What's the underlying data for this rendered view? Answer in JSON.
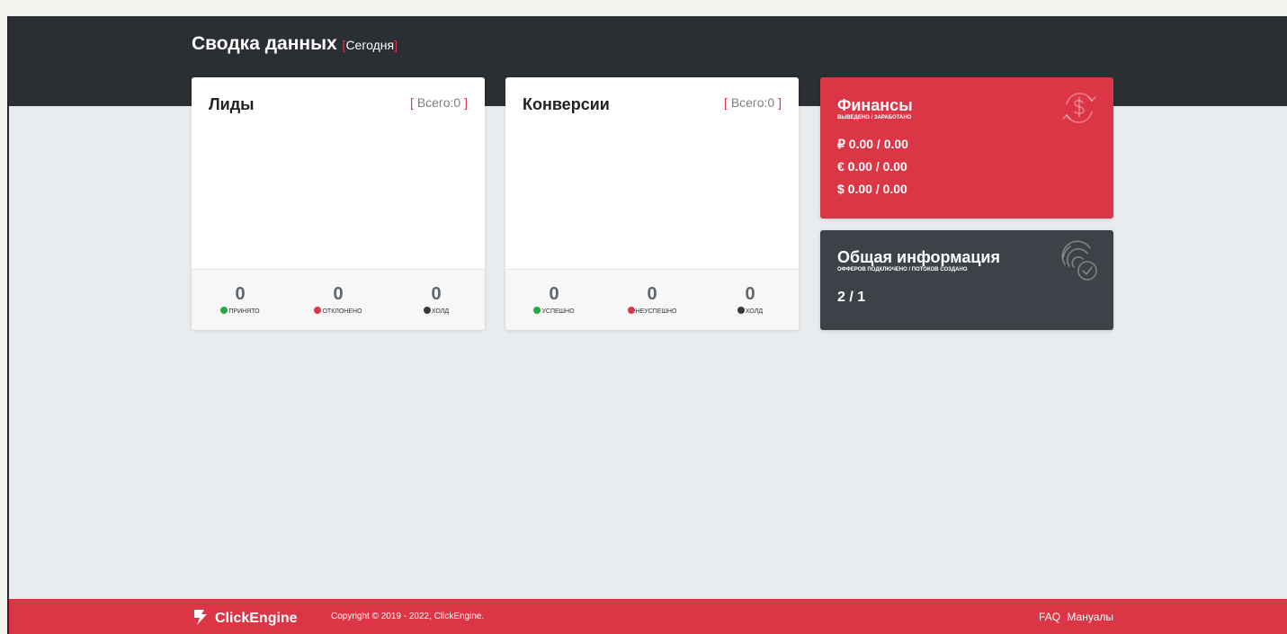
{
  "header": {
    "title": "Сводка данных",
    "bracket_open": "[",
    "period": "Сегодня",
    "bracket_close": "]"
  },
  "leads": {
    "title": "Лиды",
    "total_label": "Всего:",
    "total_value": "0",
    "stats": [
      {
        "value": "0",
        "label": "ПРИНЯТО",
        "color": "#28a745"
      },
      {
        "value": "0",
        "label": "ОТКЛОНЕНО",
        "color": "#dc3545"
      },
      {
        "value": "0",
        "label": "ХОЛД",
        "color": "#343a40"
      }
    ]
  },
  "conversions": {
    "title": "Конверсии",
    "total_label": "Всего:",
    "total_value": "0",
    "stats": [
      {
        "value": "0",
        "label": "УСПЕШНО",
        "color": "#28a745"
      },
      {
        "value": "0",
        "label": "НЕУСПЕШНО",
        "color": "#dc3545"
      },
      {
        "value": "0",
        "label": "ХОЛД",
        "color": "#343a40"
      }
    ]
  },
  "finance": {
    "title": "Финансы",
    "subtitle": "ВЫВЕДЕНО / ЗАРАБОТАНО",
    "rub": "₽ 0.00 / 0.00",
    "eur": "€ 0.00 / 0.00",
    "usd": "$ 0.00 / 0.00",
    "icon": "dollar-cycle-icon",
    "color": "#dc3545"
  },
  "general": {
    "title": "Общая информация",
    "subtitle": "ОФФЕРОВ ПОДКЛЮЧЕНО / ПОТОКОВ СОЗДАНО",
    "value": "2 / 1",
    "icon": "fingerprint-check-icon",
    "color": "#3d4248"
  },
  "footer": {
    "brand": "ClickEngine",
    "copyright": "Copyright © 2019 - 2022, ClickEngine.",
    "links": [
      "FAQ",
      "Мануалы"
    ]
  },
  "colors": {
    "accent": "#dc3545",
    "header_bg": "#2b2f34",
    "body_bg": "#e9ecef"
  }
}
